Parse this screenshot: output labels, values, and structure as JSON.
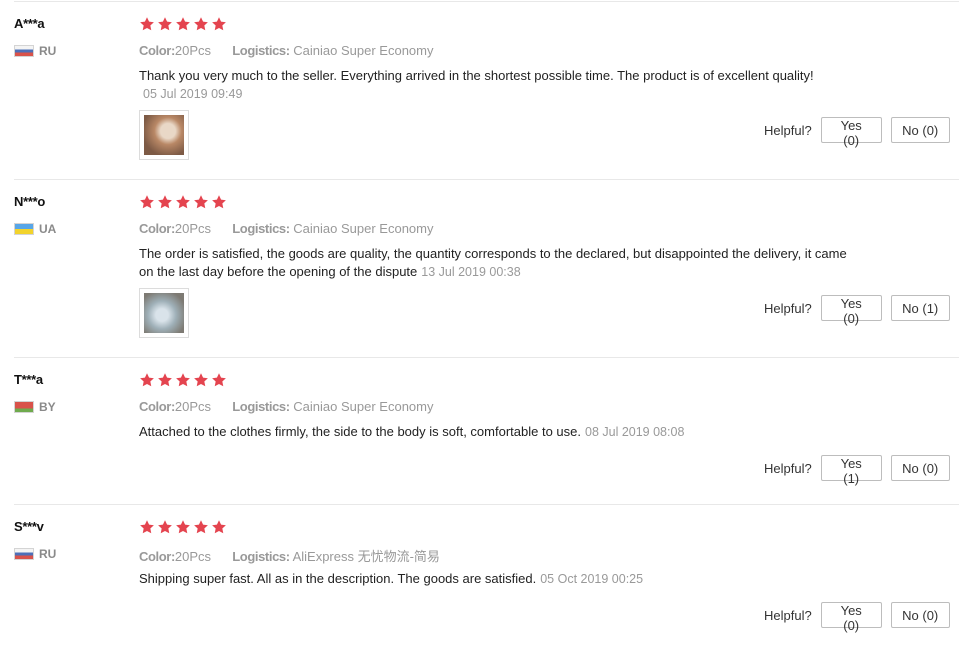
{
  "labels": {
    "color_key": "Color:",
    "logistics_key": "Logistics:",
    "helpful": "Helpful?"
  },
  "colors": {
    "star": "#e4444f"
  },
  "reviews": [
    {
      "name": "A***a",
      "country": "RU",
      "flag": "russia-flag-icon",
      "rating": 5,
      "color": "20Pcs",
      "logistics": "Cainiao Super Economy",
      "text": "Thank you very much to the seller. Everything arrived in the shortest possible time. The product is of excellent quality!",
      "date": "05 Jul 2019 09:49",
      "yes": "Yes (0)",
      "no": "No (0)"
    },
    {
      "name": "N***o",
      "country": "UA",
      "flag": "ukraine-flag-icon",
      "rating": 5,
      "color": "20Pcs",
      "logistics": "Cainiao Super Economy",
      "text": "The order is satisfied, the goods are quality, the quantity corresponds to the declared, but disappointed the delivery, it came on the last day before the opening of the dispute",
      "date": "13 Jul 2019 00:38",
      "yes": "Yes (0)",
      "no": "No (1)"
    },
    {
      "name": "T***a",
      "country": "BY",
      "flag": "belarus-flag-icon",
      "rating": 5,
      "color": "20Pcs",
      "logistics": "Cainiao Super Economy",
      "text": "Attached to the clothes firmly, the side to the body is soft, comfortable to use.",
      "date": "08 Jul 2019 08:08",
      "yes": "Yes (1)",
      "no": "No (0)"
    },
    {
      "name": "S***v",
      "country": "RU",
      "flag": "russia-flag-icon",
      "rating": 5,
      "color": "20Pcs",
      "logistics": "AliExpress 无忧物流-简易",
      "text": "Shipping super fast. All as in the description. The goods are satisfied.",
      "date": "05 Oct 2019 00:25",
      "yes": "Yes (0)",
      "no": "No (0)"
    }
  ]
}
